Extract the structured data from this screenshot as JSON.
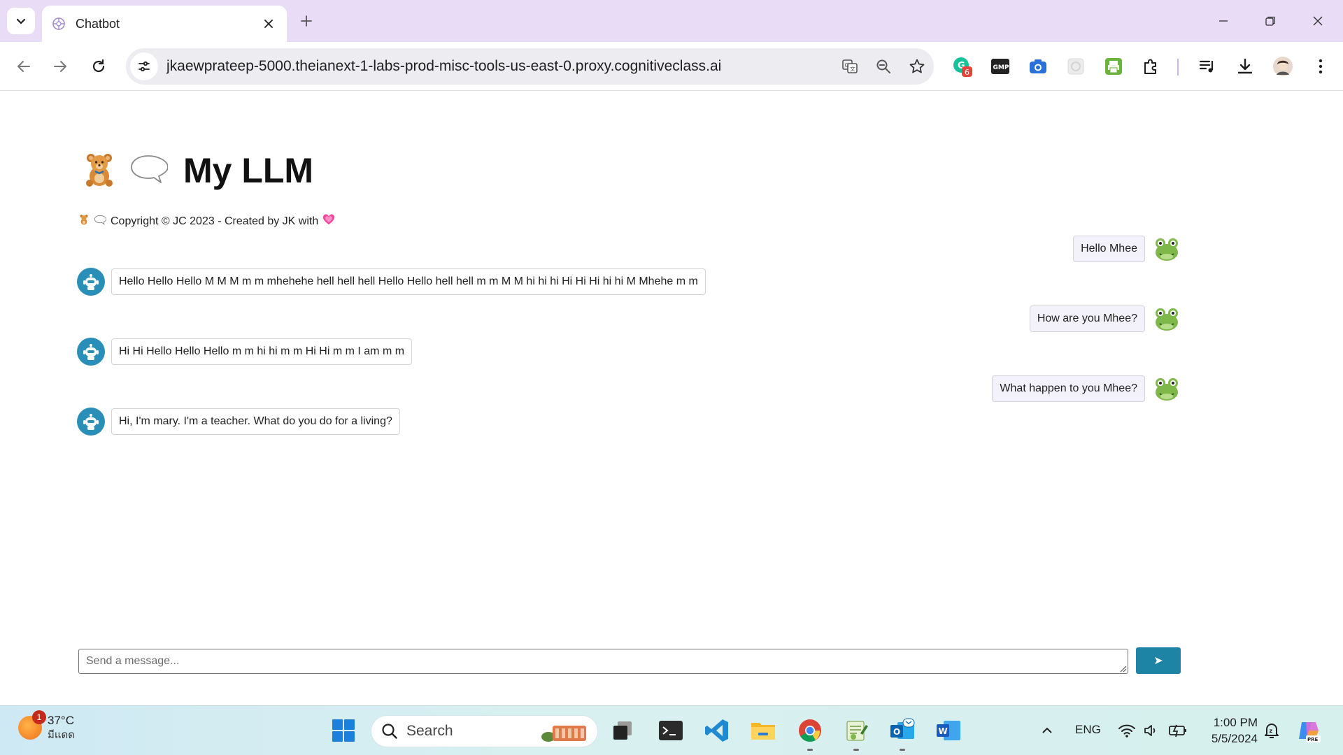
{
  "browser": {
    "tab": {
      "title": "Chatbot"
    },
    "url": "jkaewprateep-5000.theianext-1-labs-prod-misc-tools-us-east-0.proxy.cognitiveclass.ai",
    "extension_badge": "6"
  },
  "page": {
    "title": "My LLM",
    "title_icons": [
      "teddy-bear-icon",
      "speech-balloon-icon"
    ],
    "copyright": "Copyright © JC 2023 - Created by JK with",
    "heart_icon": "pink-heart-icon"
  },
  "chat": {
    "messages": [
      {
        "role": "user",
        "text": "Hello Mhee"
      },
      {
        "role": "bot",
        "text": "Hello Hello Hello M M M m m mhehehe hell hell hell Hello Hello hell hell m m M M hi hi hi Hi Hi Hi hi hi M Mhehe m m"
      },
      {
        "role": "user",
        "text": "How are you Mhee?"
      },
      {
        "role": "bot",
        "text": "Hi Hi Hello Hello Hello m m hi hi m m Hi Hi m m I am m m"
      },
      {
        "role": "user",
        "text": "What happen to you Mhee?"
      },
      {
        "role": "bot",
        "text": "Hi, I'm mary. I'm a teacher. What do you do for a living?"
      }
    ],
    "input_placeholder": "Send a message...",
    "send_label": "➤"
  },
  "taskbar": {
    "weather_temp": "37°C",
    "weather_desc": "มีแดด",
    "weather_badge": "1",
    "search_label": "Search",
    "language": "ENG",
    "time": "1:00 PM",
    "date": "5/5/2024"
  },
  "colors": {
    "tabstrip": "#e9dcf7",
    "send_button": "#1d84a6",
    "bot_avatar": "#2a8fb8"
  }
}
